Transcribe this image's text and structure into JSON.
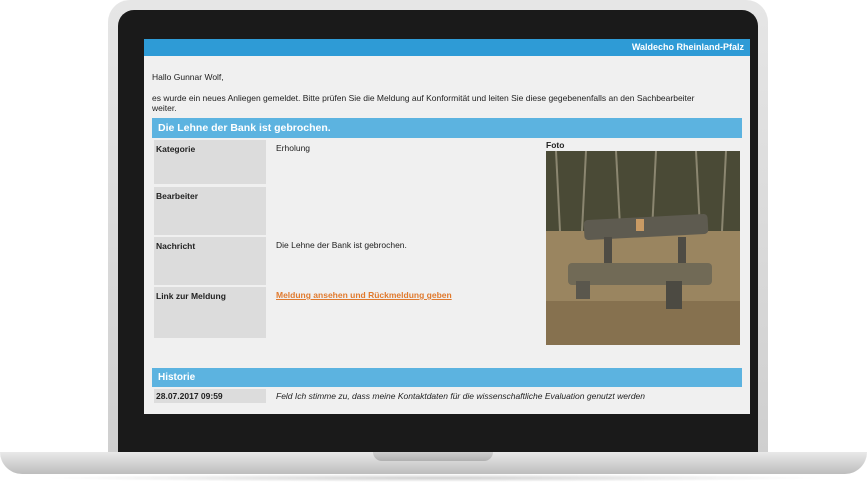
{
  "header": {
    "brand": "Waldecho Rheinland-Pfalz"
  },
  "email": {
    "greeting": "Hallo Gunnar Wolf,",
    "intro": "es wurde ein neues Anliegen gemeldet. Bitte prüfen Sie die Meldung auf Konformität und leiten Sie diese gegebenenfalls an den Sachbearbeiter weiter.",
    "title": "Die Lehne der Bank ist gebrochen.",
    "fields": {
      "kategorie_label": "Kategorie",
      "kategorie_value": "Erholung",
      "bearbeiter_label": "Bearbeiter",
      "bearbeiter_value": "",
      "nachricht_label": "Nachricht",
      "nachricht_value": "Die Lehne der Bank ist gebrochen.",
      "link_label": "Link zur Meldung",
      "link_text": "Meldung ansehen und Rückmeldung geben"
    },
    "foto_label": "Foto"
  },
  "history": {
    "title": "Historie",
    "entries": [
      {
        "date": "28.07.2017 09:59",
        "text": "Feld Ich stimme zu, dass meine Kontaktdaten für die wissenschaftliche Evaluation genutzt werden"
      }
    ]
  }
}
